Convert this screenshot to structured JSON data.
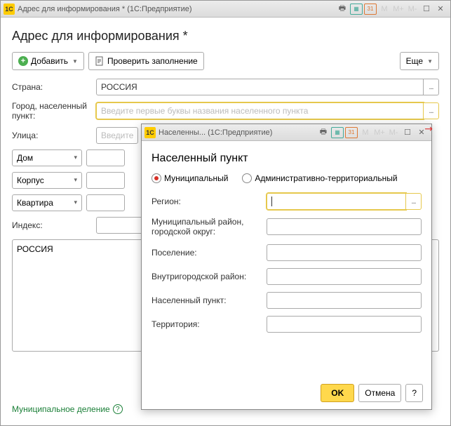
{
  "main_window": {
    "title": "Адрес для информирования *  (1С:Предприятие)",
    "app_icon_text": "1C",
    "page_title": "Адрес для информирования *",
    "toolbar": {
      "add_label": "Добавить",
      "check_label": "Проверить заполнение",
      "more_label": "Еще"
    },
    "fields": {
      "country_label": "Страна:",
      "country_value": "РОССИЯ",
      "city_label": "Город, населенный пункт:",
      "city_placeholder": "Введите первые буквы названия населенного пункта",
      "street_label": "Улица:",
      "street_placeholder": "Введите",
      "house_select": "Дом",
      "korpus_select": "Корпус",
      "apartment_select": "Квартира",
      "index_label": "Индекс:",
      "summary_value": "РОССИЯ"
    },
    "footer_link": "Муниципальное деление"
  },
  "dialog": {
    "titlebar": "Населенны...  (1С:Предприятие)",
    "app_icon_text": "1C",
    "title": "Населенный пункт",
    "radio_municipal": "Муниципальный",
    "radio_adm": "Административно-территориальный",
    "labels": {
      "region": "Регион:",
      "mun_district": "Муниципальный район, городской округ:",
      "settlement": "Поселение:",
      "intracity": "Внутригородской район:",
      "locality": "Населенный пункт:",
      "territory": "Территория:"
    },
    "buttons": {
      "ok": "OK",
      "cancel": "Отмена",
      "help": "?"
    },
    "tb_m": "M",
    "tb_mp": "M+",
    "tb_mm": "M-"
  }
}
